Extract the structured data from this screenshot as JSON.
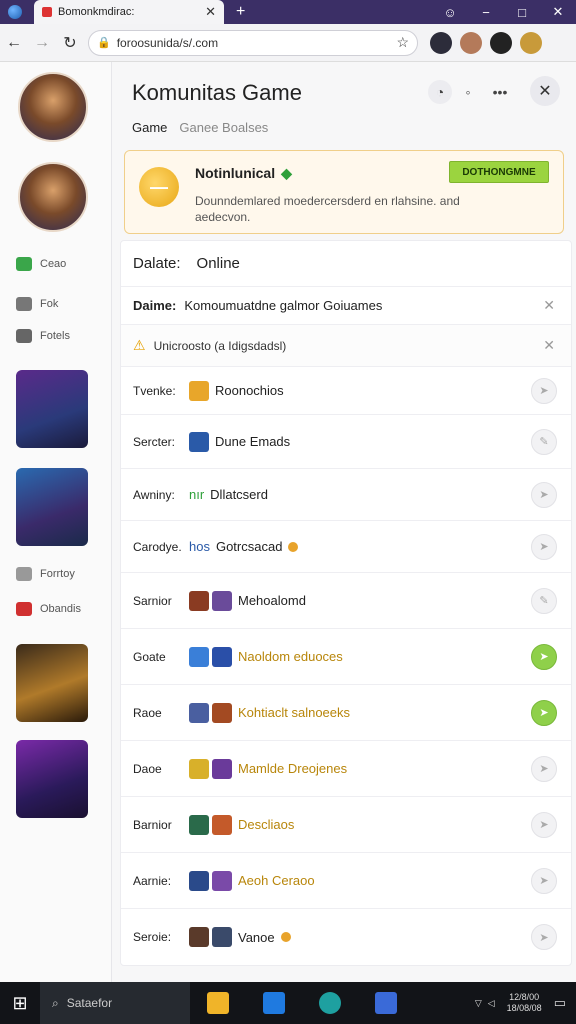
{
  "browser": {
    "tab_title": "Bomonkmdirac:",
    "new_tab": "+",
    "url": "foroosunida/s/.com",
    "controls": [
      "−",
      "□",
      "✕"
    ]
  },
  "rail": {
    "links": [
      {
        "label": "Ceao",
        "icon": "chat-icon",
        "color": "#3aa64a"
      },
      {
        "label": "Fok",
        "icon": "grid-icon",
        "color": "#555555"
      },
      {
        "label": "Fotels",
        "icon": "cross-icon",
        "color": "#555555"
      },
      {
        "label": "Forrtoy",
        "icon": "warning-icon",
        "color": "#888888"
      },
      {
        "label": "Obandis",
        "icon": "flag-icon",
        "color": "#d03030"
      }
    ]
  },
  "panel": {
    "title": "Komunitas Game",
    "subnav": {
      "active": "Game",
      "inactive": "Ganee Boalses"
    },
    "notice": {
      "title": "Notinlunical",
      "body": "Dounndemlared moedercersderd en rlahsine. and aedecvon.",
      "button": "DOTHONGMNE",
      "coin": "—"
    },
    "head": {
      "key": "Dalate:",
      "value": "Online"
    },
    "info": {
      "key": "Daime:",
      "value": "Komoumuatdne galmor Goiuames"
    },
    "warning": "Unicroosto (a Idigsdadsl)",
    "items": [
      {
        "key": "Tvenke:",
        "value": "Roonochios",
        "gold": false,
        "badge": false,
        "green": false,
        "colors": [
          "#e8a62a"
        ]
      },
      {
        "key": "Sercter:",
        "value": "Dune Emads",
        "gold": false,
        "badge": false,
        "green": false,
        "colors": [
          "#2a5aa8"
        ]
      },
      {
        "key": "Awniny:",
        "value": "Dllatcserd",
        "prefix": "nır",
        "gold": false,
        "badge": false,
        "green": false,
        "colors": []
      },
      {
        "key": "Carodye.",
        "value": "Gotrcsacad",
        "prefix": "hos",
        "gold": false,
        "badge": true,
        "green": false,
        "colors": []
      },
      {
        "key": "Sarnior",
        "value": "Mehoalomd",
        "gold": false,
        "badge": false,
        "green": false,
        "colors": [
          "#8a3b22",
          "#6a4b9a"
        ]
      },
      {
        "key": "Goate",
        "value": "Naoldom eduoces",
        "gold": true,
        "badge": false,
        "green": true,
        "colors": [
          "#3a7fd8",
          "#2a4fa8"
        ]
      },
      {
        "key": "Raoe",
        "value": "Kohtiaclt salnoeeks",
        "gold": true,
        "badge": false,
        "green": true,
        "colors": [
          "#4a5fa0",
          "#a34a22"
        ]
      },
      {
        "key": "Daoe",
        "value": "Mamlde Dreojenes",
        "gold": true,
        "badge": false,
        "green": false,
        "colors": [
          "#d8b02a",
          "#6a3a9a"
        ]
      },
      {
        "key": "Barnior",
        "value": "Descliaos",
        "gold": true,
        "badge": false,
        "green": false,
        "colors": [
          "#2a6a4a",
          "#c45a2a"
        ]
      },
      {
        "key": "Aarnie:",
        "value": "Aeoh Ceraoo",
        "gold": true,
        "badge": false,
        "green": false,
        "colors": [
          "#2a4a8a",
          "#7a4aa8"
        ]
      },
      {
        "key": "Seroie:",
        "value": "Vanoe",
        "gold": false,
        "badge": true,
        "green": false,
        "colors": [
          "#5a3a2a",
          "#3a4a6a"
        ]
      }
    ]
  },
  "taskbar": {
    "search_label": "Sataefor",
    "clock_top": "12/8/00",
    "clock_bottom": "18/08/08"
  }
}
